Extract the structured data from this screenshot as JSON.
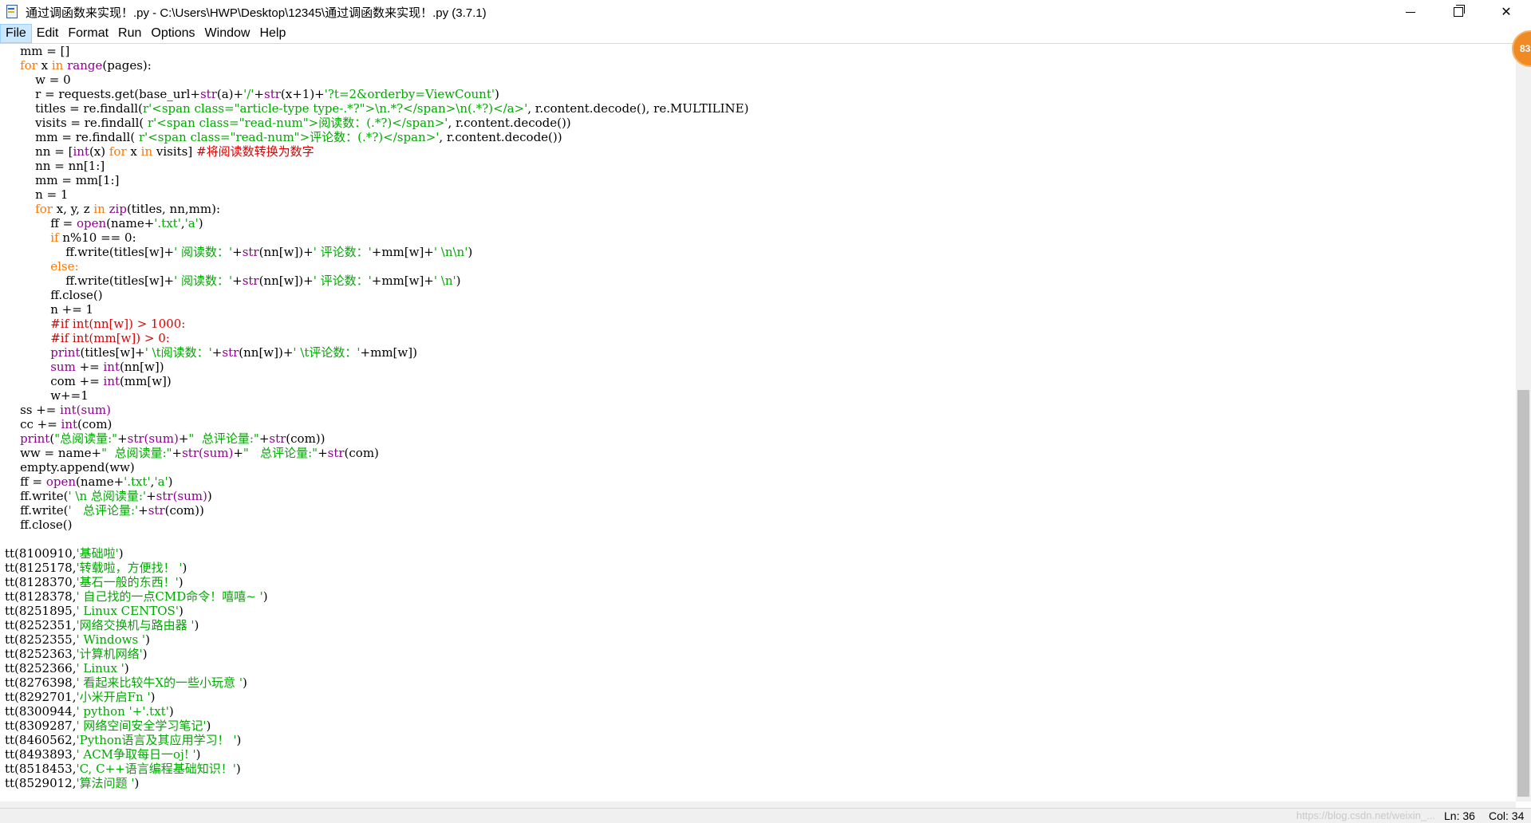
{
  "window": {
    "title": "通过调函数来实现！.py - C:\\Users\\HWP\\Desktop\\12345\\通过调函数来实现！.py (3.7.1)",
    "app_icon": "idle-python-file-icon"
  },
  "controls": {
    "minimize": "minimize-icon",
    "maximize": "maximize-icon",
    "close": "✕"
  },
  "menu": [
    "File",
    "Edit",
    "Format",
    "Run",
    "Options",
    "Window",
    "Help"
  ],
  "badge": {
    "text": "83"
  },
  "colors": {
    "keyword": "#ff7700",
    "builtin": "#900090",
    "string": "#00aa00",
    "comment": "#dd0000"
  },
  "code": {
    "l1": "    mm = []",
    "l2_for": "for",
    "l2_in": "in",
    "l2_range": "range",
    "l2_end": "(pages):",
    "l3": "        w = 0",
    "l4_a": "        r = requests.get(base_url+",
    "l4_str": "str",
    "l4_b": "(a)+",
    "l4_s1": "'/'",
    "l4_c": "+",
    "l4_str2": "str",
    "l4_d": "(x+1)+",
    "l4_s2": "'?t=2&orderby=ViewCount'",
    "l4_e": ")",
    "l5_a": "        titles = re.findall(",
    "l5_s": "r'<span class=\"article-type type-.*?\">\\n.*?</span>\\n(.*?)</a>'",
    "l5_b": ", r.content.decode(), re.MULTILINE)",
    "l6_a": "        visits = re.findall( ",
    "l6_s": "r'<span class=\"read-num\">阅读数：(.*?)</span>'",
    "l6_b": ", r.content.decode())",
    "l7_a": "        mm = re.findall( ",
    "l7_s": "r'<span class=\"read-num\">评论数：(.*?)</span>'",
    "l7_b": ", r.content.decode())",
    "l8_a": "        nn = [",
    "l8_int": "int",
    "l8_b": "(x) ",
    "l8_for": "for",
    "l8_c": " x ",
    "l8_in": "in",
    "l8_d": " visits] ",
    "l8_cmt": "#将阅读数转换为数字",
    "l9": "        nn = nn[1:]",
    "l10": "        mm = mm[1:]",
    "l11": "        n = 1",
    "l12_for": "for",
    "l12_a": " x, y, z ",
    "l12_in": "in",
    "l12_zip": "zip",
    "l12_b": "(titles, nn,mm):",
    "l13_a": "            ff = ",
    "l13_open": "open",
    "l13_b": "(name+",
    "l13_s1": "'.txt'",
    "l13_c": ",",
    "l13_s2": "'a'",
    "l13_d": ")",
    "l14_if": "if",
    "l14_a": " n%10 == 0:",
    "l15_a": "                ff.write(titles[w]+",
    "l15_s1": "' 阅读数：'",
    "l15_b": "+",
    "l15_str1": "str",
    "l15_c": "(nn[w])+",
    "l15_s2": "' 评论数：'",
    "l15_d": "+mm[w]+",
    "l15_s3": "' \\n\\n'",
    "l15_e": ")",
    "l16_else": "else",
    "l16_a": ":",
    "l17_a": "                ff.write(titles[w]+",
    "l17_s1": "' 阅读数：'",
    "l17_b": "+",
    "l17_str1": "str",
    "l17_c": "(nn[w])+",
    "l17_s2": "' 评论数：'",
    "l17_d": "+mm[w]+",
    "l17_s3": "' \\n'",
    "l17_e": ")",
    "l18": "            ff.close()",
    "l19": "            n += 1",
    "l20": "            #if int(nn[w]) > 1000:",
    "l21": "            #if int(mm[w]) > 0:",
    "l22_print": "print",
    "l22_a": "(titles[w]+",
    "l22_s1": "' \\t阅读数：'",
    "l22_b": "+",
    "l22_str": "str",
    "l22_c": "(nn[w])+",
    "l22_s2": "' \\t评论数：'",
    "l22_d": "+mm[w])",
    "l23_sum": "sum",
    "l23_a": " += ",
    "l23_int": "int",
    "l23_b": "(nn[w])",
    "l24_a": "            com += ",
    "l24_int": "int",
    "l24_b": "(mm[w])",
    "l25": "            w+=1",
    "l26_a": "    ss += ",
    "l26_int": "int",
    "l26_sum": "(sum)",
    "l27_a": "    cc += ",
    "l27_int": "int",
    "l27_b": "(com)",
    "l28_print": "print",
    "l28_a": "(",
    "l28_s1": "\"总阅读量:\"",
    "l28_b": "+",
    "l28_str1": "str",
    "l28_sum": "(sum)",
    "l28_c": "+",
    "l28_s2": "\"  总评论量:\"",
    "l28_d": "+",
    "l28_str2": "str",
    "l28_e": "(com))",
    "l29_a": "    ww = name+",
    "l29_s1": "\"  总阅读量:\"",
    "l29_b": "+",
    "l29_str1": "str",
    "l29_sum": "(sum)",
    "l29_c": "+",
    "l29_s2": "\"   总评论量:\"",
    "l29_d": "+",
    "l29_str2": "str",
    "l29_e": "(com)",
    "l30": "    empty.append(ww)",
    "l31_a": "    ff = ",
    "l31_open": "open",
    "l31_b": "(name+",
    "l31_s1": "'.txt'",
    "l31_c": ",",
    "l31_s2": "'a'",
    "l31_d": ")",
    "l32_a": "    ff.write(",
    "l32_s": "' \\n 总阅读量:'",
    "l32_b": "+",
    "l32_str": "str",
    "l32_sum": "(sum)",
    "l32_c": ")",
    "l33_a": "    ff.write(",
    "l33_s": "'   总评论量:'",
    "l33_b": "+",
    "l33_str": "str",
    "l33_c": "(com))",
    "l34": "    ff.close()"
  },
  "calls": [
    {
      "pre": "tt(8100910,",
      "s": "'基础啦'",
      "post": ")"
    },
    {
      "pre": "tt(8125178,",
      "s": "'转载啦，方便找！ '",
      "post": ")"
    },
    {
      "pre": "tt(8128370,",
      "s": "'基石一般的东西！'",
      "post": ")"
    },
    {
      "pre": "tt(8128378,",
      "s": "' 自己找的一点CMD命令！嘻嘻~ '",
      "post": ")"
    },
    {
      "pre": "tt(8251895,",
      "s": "' Linux CENTOS'",
      "post": ")"
    },
    {
      "pre": "tt(8252351,",
      "s": "'网络交换机与路由器 '",
      "post": ")"
    },
    {
      "pre": "tt(8252355,",
      "s": "' Windows '",
      "post": ")"
    },
    {
      "pre": "tt(8252363,",
      "s": "'计算机网络'",
      "post": ")"
    },
    {
      "pre": "tt(8252366,",
      "s": "' Linux '",
      "post": ")"
    },
    {
      "pre": "tt(8276398,",
      "s": "' 看起来比较牛X的一些小玩意 '",
      "post": ")"
    },
    {
      "pre": "tt(8292701,",
      "s": "'小米开启Fn '",
      "post": ")"
    },
    {
      "pre": "tt(8300944,",
      "s": "' python '+'.txt'",
      "post": ")"
    },
    {
      "pre": "tt(8309287,",
      "s": "' 网络空间安全学习笔记'",
      "post": ")"
    },
    {
      "pre": "tt(8460562,",
      "s": "'Python语言及其应用学习！ '",
      "post": ")"
    },
    {
      "pre": "tt(8493893,",
      "s": "' ACM争取每日一oj! '",
      "post": ")"
    },
    {
      "pre": "tt(8518453,",
      "s": "'C, C++语言编程基础知识！'",
      "post": ")"
    },
    {
      "pre": "tt(8529012,",
      "s": "'算法问题 '",
      "post": ")"
    }
  ],
  "status": {
    "watermark": "https://blog.csdn.net/weixin_...",
    "ln": "Ln: 36",
    "col": "Col: 34"
  }
}
